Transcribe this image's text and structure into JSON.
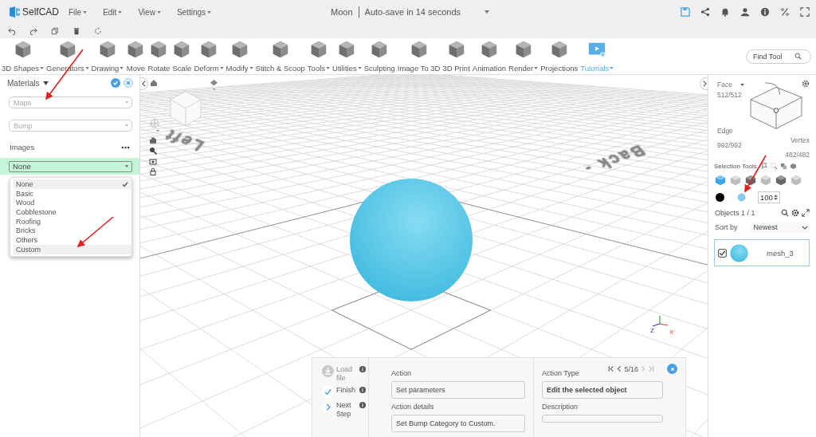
{
  "app": {
    "name": "SelfCAD",
    "menus": [
      {
        "label": "File"
      },
      {
        "label": "Edit"
      },
      {
        "label": "View"
      },
      {
        "label": "Settings"
      }
    ]
  },
  "document": {
    "title": "Moon",
    "autosave": "Auto-save in 14 seconds"
  },
  "tools": [
    {
      "label": "3D Shapes",
      "dropdown": true,
      "highlighted": false
    },
    {
      "label": "Generators",
      "dropdown": true,
      "highlighted": false
    },
    {
      "label": "Drawing",
      "dropdown": true,
      "highlighted": false
    },
    {
      "label": "Move",
      "dropdown": false,
      "highlighted": false
    },
    {
      "label": "Rotate",
      "dropdown": false,
      "highlighted": false
    },
    {
      "label": "Scale",
      "dropdown": false,
      "highlighted": false
    },
    {
      "label": "Deform",
      "dropdown": true,
      "highlighted": false
    },
    {
      "label": "Modify",
      "dropdown": true,
      "highlighted": false
    },
    {
      "label": "Stitch & Scoop",
      "dropdown": false,
      "highlighted": false
    },
    {
      "label": "Tools",
      "dropdown": true,
      "highlighted": false
    },
    {
      "label": "Utilities",
      "dropdown": true,
      "highlighted": false
    },
    {
      "label": "Sculpting",
      "dropdown": false,
      "highlighted": false
    },
    {
      "label": "Image To 3D",
      "dropdown": false,
      "highlighted": false
    },
    {
      "label": "3D Print",
      "dropdown": false,
      "highlighted": false
    },
    {
      "label": "Animation",
      "dropdown": false,
      "highlighted": false
    },
    {
      "label": "Render",
      "dropdown": true,
      "highlighted": false
    },
    {
      "label": "Projections",
      "dropdown": false,
      "highlighted": false
    },
    {
      "label": "Tutorials",
      "dropdown": true,
      "highlighted": true
    }
  ],
  "find_tool": {
    "placeholder": "Find Tool"
  },
  "materials": {
    "title": "Materials",
    "maps": {
      "placeholder": "Maps"
    },
    "bump": {
      "placeholder": "Bump"
    },
    "images_label": "Images",
    "select": {
      "value": "None"
    },
    "options": [
      {
        "label": "None",
        "selected": true,
        "hovered": false
      },
      {
        "label": "Basic",
        "selected": false,
        "hovered": false
      },
      {
        "label": "Wood",
        "selected": false,
        "hovered": false
      },
      {
        "label": "Cobblestone",
        "selected": false,
        "hovered": false
      },
      {
        "label": "Roofing",
        "selected": false,
        "hovered": false
      },
      {
        "label": "Bricks",
        "selected": false,
        "hovered": false
      },
      {
        "label": "Others",
        "selected": false,
        "hovered": false
      },
      {
        "label": "Custom",
        "selected": false,
        "hovered": true
      }
    ]
  },
  "viewport": {
    "ground_labels": [
      "Left",
      "Back -"
    ],
    "axis_labels": [
      "Z",
      "X"
    ]
  },
  "right": {
    "face_label": "Face",
    "face_count": "512/512",
    "edge_label": "Edge",
    "edge_count": "992/992",
    "vertex_label": "Vertex",
    "vertex_count": "482/482",
    "selection_tools": "Selection Tools",
    "modes": [
      {
        "selected": true
      },
      {
        "selected": false
      },
      {
        "selected": false
      },
      {
        "selected": false
      },
      {
        "selected": false
      },
      {
        "selected": false
      }
    ],
    "size": "100",
    "objects_label": "Objects 1 / 1",
    "sort_label": "Sort by",
    "sort_value": "Newest",
    "objects": [
      {
        "name": "mesh_3",
        "checked": true
      }
    ]
  },
  "tutorial": {
    "steps": [
      {
        "kind": "load",
        "label": "Load file",
        "disabled": true
      },
      {
        "kind": "finish",
        "label": "Finish",
        "disabled": false
      },
      {
        "kind": "next",
        "label": "Next Step",
        "disabled": false
      }
    ],
    "page": "5/16",
    "action_label": "Action",
    "action": "Set parameters",
    "details_label": "Action details",
    "details": "Set Bump Category to Custom.",
    "type_label": "Action Type",
    "type": "Edit the selected object",
    "description_label": "Description"
  }
}
